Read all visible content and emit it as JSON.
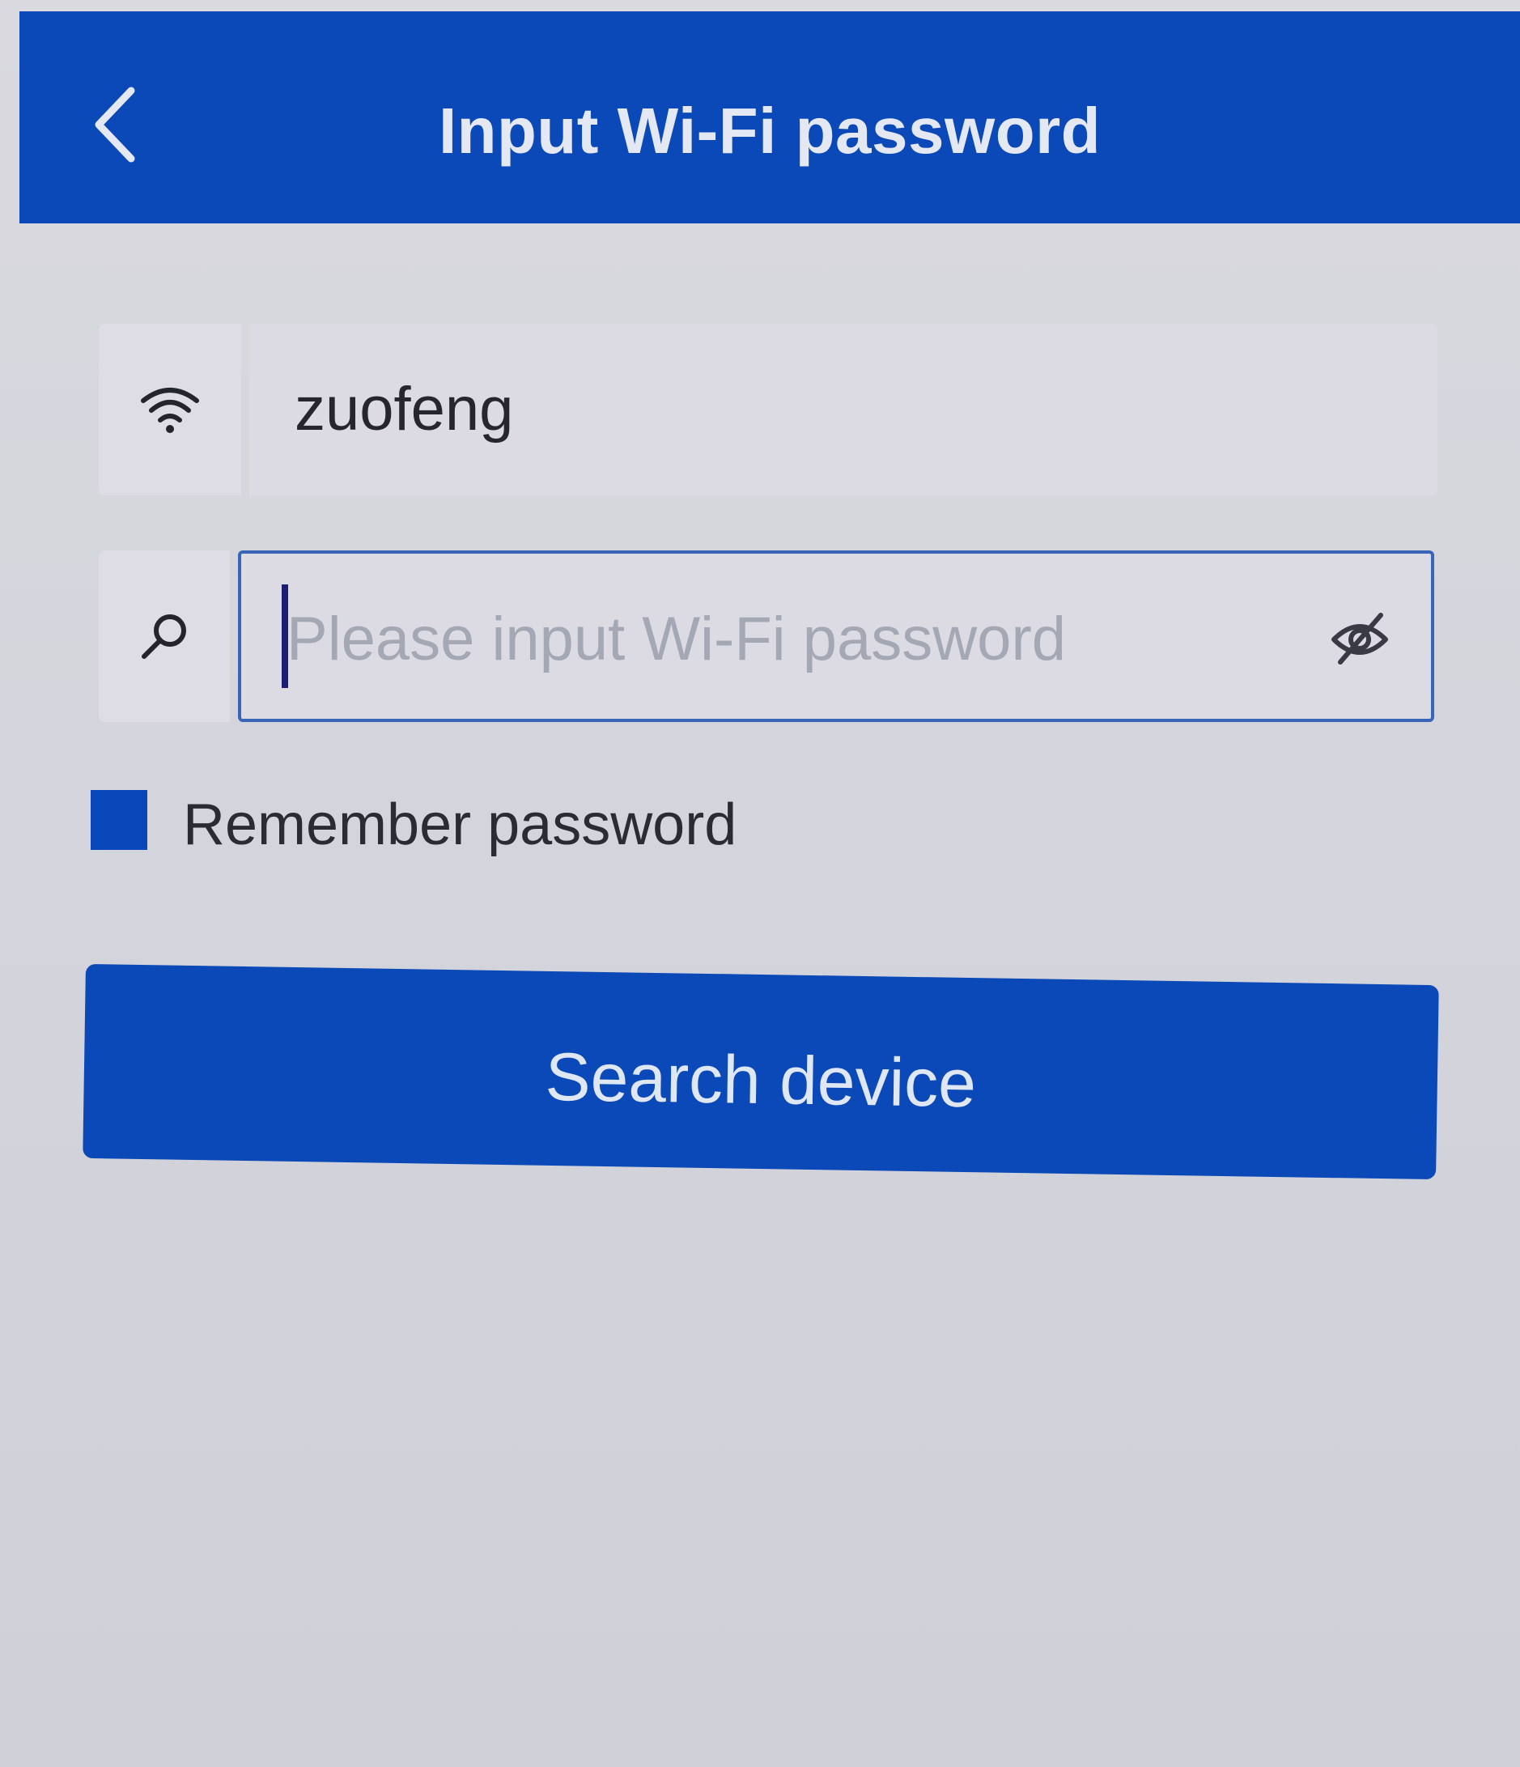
{
  "header": {
    "title": "Input Wi-Fi password",
    "back_icon": "chevron-left-icon",
    "color": "#0b49b8"
  },
  "ssid": {
    "icon": "wifi-icon",
    "value": "zuofeng"
  },
  "password": {
    "icon": "key-icon",
    "placeholder": "Please input Wi-Fi password",
    "value": "",
    "visibility_icon": "eye-off-icon",
    "border_color": "#3a64b7"
  },
  "remember": {
    "label": "Remember password",
    "checked": true,
    "color": "#0a47bb"
  },
  "actions": {
    "search_label": "Search device",
    "color": "#0b49b8"
  }
}
